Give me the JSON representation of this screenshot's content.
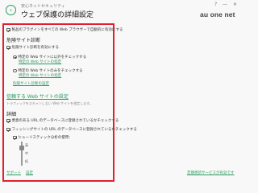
{
  "header": {
    "back_icon": "‹",
    "subtitle": "安心ネットセキュリティ",
    "title": "ウェブ保護の詳細設定",
    "logo": "au one net",
    "win_controls": [
      "?",
      "—",
      "✕"
    ]
  },
  "settings": {
    "browser_ext_label": "製品のプラグインをすべての Web ブラウザーで自動的に有効にする",
    "danger_heading": "危険サイト診断",
    "danger_enable_label": "危険サイト診断を有効にする",
    "radio1_label": "特定の Web サイトに以外をチェックする",
    "radio1_link": "特定の Web サイトの指定",
    "radio2_label": "特定の Web サイトのみをチェックする",
    "radio2_link": "特定の Web サイトの指定",
    "danger_settings_link": "危険サイト診断の設定",
    "trusted_heading": "信頼する Web サイトの設定",
    "trusted_desc": "トラフィックをスキャンしない Web サイトを指定します。",
    "detail_heading": "詳細",
    "detail1_label": "悪意のある URL のデータベースに登録されているかチェックする",
    "detail2_label": "フィッシングサイトの URL のデータベースに登録されているかチェックする",
    "heuristic_label": "ヒューリスティック分析の使用：",
    "levels": [
      "高",
      "中",
      "低"
    ]
  },
  "footer": {
    "support": "サポート",
    "settings": "設定",
    "auto_update": "定期更新サービスが有効です"
  },
  "colors": {
    "accent": "#2e9b62",
    "highlight_box": "#e0202c"
  }
}
